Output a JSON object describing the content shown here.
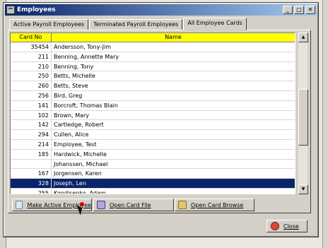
{
  "window": {
    "title": "Employees",
    "buttons": [
      "_",
      "□",
      "✕"
    ]
  },
  "tabs": [
    {
      "label": "Active Payroll Employees"
    },
    {
      "label": "Terminated Payroll Employees"
    },
    {
      "label": "All Employee Cards",
      "active": true
    }
  ],
  "grid": {
    "headers": {
      "card_no": "Card No",
      "name": "Name"
    },
    "rows": [
      {
        "card_no": "35454",
        "name": "Andersson, Tony-Jim"
      },
      {
        "card_no": "211",
        "name": "Benning, Annette Mary"
      },
      {
        "card_no": "210",
        "name": "Benning, Tony"
      },
      {
        "card_no": "250",
        "name": "Betts, Michelle"
      },
      {
        "card_no": "260",
        "name": "Betts, Steve"
      },
      {
        "card_no": "256",
        "name": "Bird, Greg"
      },
      {
        "card_no": "141",
        "name": "Borcroft, Thomas Blain"
      },
      {
        "card_no": "102",
        "name": "Brown, Mary"
      },
      {
        "card_no": "142",
        "name": "Cartledge, Robert"
      },
      {
        "card_no": "294",
        "name": "Cullen, Alice"
      },
      {
        "card_no": "214",
        "name": "Employee, Test"
      },
      {
        "card_no": "185",
        "name": "Hardwick, Michelle"
      },
      {
        "card_no": "",
        "name": "Johanssen, Michael"
      },
      {
        "card_no": "167",
        "name": "Jorgensen, Karen"
      },
      {
        "card_no": "328",
        "name": "Joseph, Len",
        "selected": true
      },
      {
        "card_no": "255",
        "name": "Kondisenko, Adam"
      }
    ]
  },
  "actions": {
    "make_active": "Make Active Employee",
    "open_card_file": "Open Card File",
    "open_card_browse": "Open Card Browse",
    "close": "Close"
  },
  "colors": {
    "title_start": "#0a246a",
    "title_end": "#a6caf0",
    "header_bg": "#ffff00",
    "selected_bg": "#0a246a"
  },
  "icons": {
    "window": "app-window-icon",
    "make_active": "card-icon",
    "open_card_file": "card-file-icon",
    "open_card_browse": "card-browse-icon",
    "close": "close-icon"
  }
}
